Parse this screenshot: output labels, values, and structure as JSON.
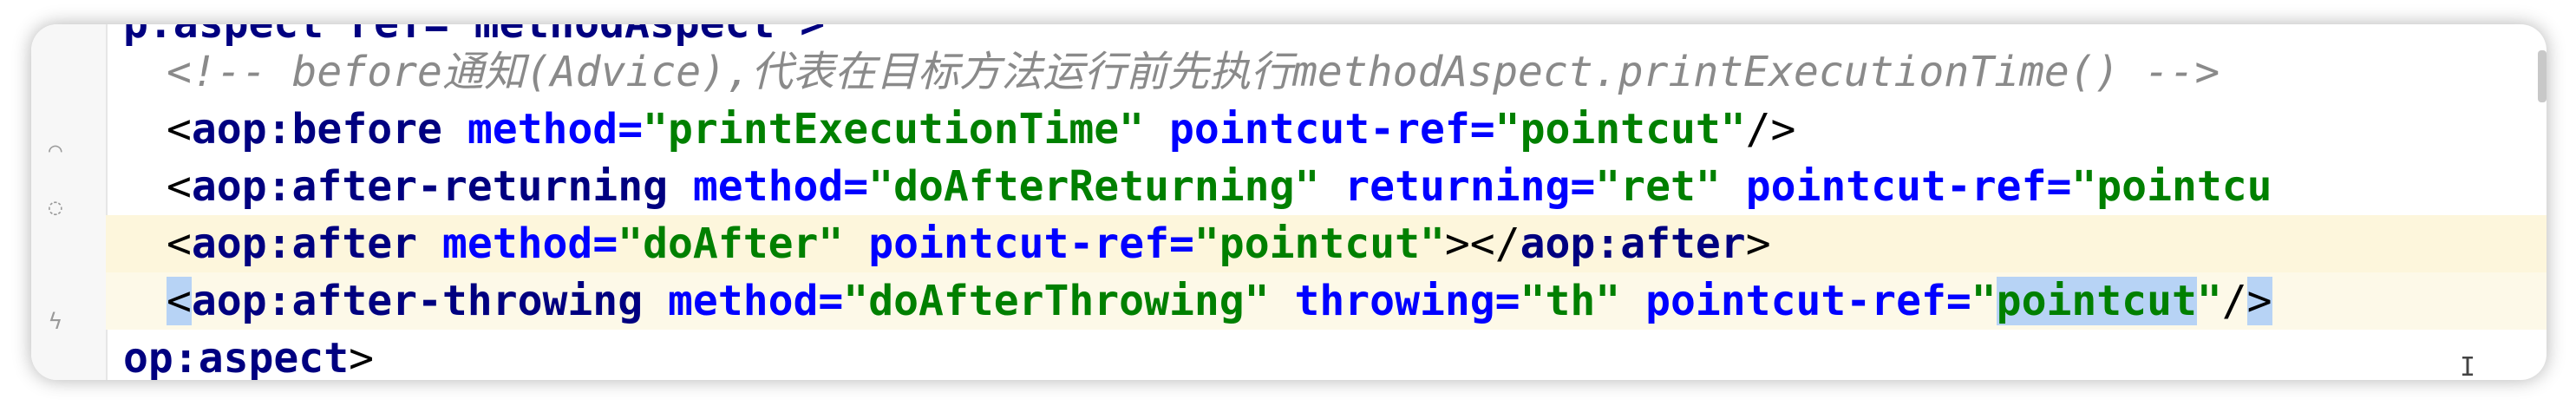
{
  "editor": {
    "gutter_icons": [
      "fold-icon",
      "breakpoint-icon",
      "run-icon"
    ],
    "lines": [
      {
        "id": "l0",
        "tokens": [
          {
            "t": "p",
            "c": "tag"
          },
          {
            "t": ":aspect ref=\"methodAspect\">",
            "c": "tag"
          }
        ]
      },
      {
        "id": "l1",
        "tokens": [
          {
            "t": "<!-- before通知(Advice),代表在目标方法运行前先执行methodAspect.printExecutionTime() -->",
            "c": "comment"
          }
        ]
      },
      {
        "id": "l2",
        "tokens": [
          {
            "t": "<",
            "c": "pun"
          },
          {
            "t": "aop",
            "c": "tag"
          },
          {
            "t": ":",
            "c": "tag"
          },
          {
            "t": "before",
            "c": "tag"
          },
          {
            "t": " ",
            "c": "pun"
          },
          {
            "t": "method",
            "c": "attr"
          },
          {
            "t": "=",
            "c": "attr"
          },
          {
            "t": "\"printExecutionTime\"",
            "c": "val"
          },
          {
            "t": " ",
            "c": "pun"
          },
          {
            "t": "pointcut-ref",
            "c": "attr"
          },
          {
            "t": "=",
            "c": "attr"
          },
          {
            "t": "\"pointcut\"",
            "c": "val"
          },
          {
            "t": "/>",
            "c": "pun"
          }
        ]
      },
      {
        "id": "l3",
        "tokens": [
          {
            "t": "<",
            "c": "pun"
          },
          {
            "t": "aop",
            "c": "tag"
          },
          {
            "t": ":",
            "c": "tag"
          },
          {
            "t": "after-returning",
            "c": "tag"
          },
          {
            "t": " ",
            "c": "pun"
          },
          {
            "t": "method",
            "c": "attr"
          },
          {
            "t": "=",
            "c": "attr"
          },
          {
            "t": "\"doAfterReturning\"",
            "c": "val"
          },
          {
            "t": " ",
            "c": "pun"
          },
          {
            "t": "returning",
            "c": "attr"
          },
          {
            "t": "=",
            "c": "attr"
          },
          {
            "t": "\"ret\"",
            "c": "val"
          },
          {
            "t": " ",
            "c": "pun"
          },
          {
            "t": "pointcut-ref",
            "c": "attr"
          },
          {
            "t": "=",
            "c": "attr"
          },
          {
            "t": "\"pointcu",
            "c": "val"
          }
        ]
      },
      {
        "id": "l4",
        "tokens": [
          {
            "t": "<",
            "c": "pun"
          },
          {
            "t": "aop",
            "c": "tag"
          },
          {
            "t": ":",
            "c": "tag"
          },
          {
            "t": "after",
            "c": "tag"
          },
          {
            "t": " ",
            "c": "pun"
          },
          {
            "t": "method",
            "c": "attr"
          },
          {
            "t": "=",
            "c": "attr"
          },
          {
            "t": "\"doAfter\"",
            "c": "val"
          },
          {
            "t": " ",
            "c": "pun"
          },
          {
            "t": "pointcut-ref",
            "c": "attr"
          },
          {
            "t": "=",
            "c": "attr"
          },
          {
            "t": "\"pointcut\"",
            "c": "val"
          },
          {
            "t": ">",
            "c": "pun"
          },
          {
            "t": "</",
            "c": "pun"
          },
          {
            "t": "aop",
            "c": "tag"
          },
          {
            "t": ":",
            "c": "tag"
          },
          {
            "t": "after",
            "c": "tag"
          },
          {
            "t": ">",
            "c": "pun"
          }
        ]
      },
      {
        "id": "l5",
        "tokens": [
          {
            "t": "<",
            "c": "pun sel"
          },
          {
            "t": "aop",
            "c": "tag"
          },
          {
            "t": ":",
            "c": "tag"
          },
          {
            "t": "after-throwing",
            "c": "tag"
          },
          {
            "t": " ",
            "c": "pun"
          },
          {
            "t": "method",
            "c": "attr"
          },
          {
            "t": "=",
            "c": "attr"
          },
          {
            "t": "\"doAfterThrowing\"",
            "c": "val"
          },
          {
            "t": " ",
            "c": "pun"
          },
          {
            "t": "throwing",
            "c": "attr"
          },
          {
            "t": "=",
            "c": "attr"
          },
          {
            "t": "\"th\"",
            "c": "val"
          },
          {
            "t": " ",
            "c": "pun"
          },
          {
            "t": "pointcut-ref",
            "c": "attr"
          },
          {
            "t": "=",
            "c": "attr"
          },
          {
            "t": "\"",
            "c": "val"
          },
          {
            "t": "pointcut",
            "c": "val sel"
          },
          {
            "t": "\"",
            "c": "val"
          },
          {
            "t": "/",
            "c": "pun"
          },
          {
            "t": ">",
            "c": "pun sel"
          }
        ]
      },
      {
        "id": "l6",
        "tokens": [
          {
            "t": "op",
            "c": "tag"
          },
          {
            "t": ":",
            "c": "tag"
          },
          {
            "t": "aspect",
            "c": "tag"
          },
          {
            "t": ">",
            "c": "pun"
          }
        ]
      }
    ]
  },
  "colors": {
    "current_line": "#fdf9e8",
    "highlighted_line": "#fdf6dc",
    "selection": "#b7d3f5"
  }
}
